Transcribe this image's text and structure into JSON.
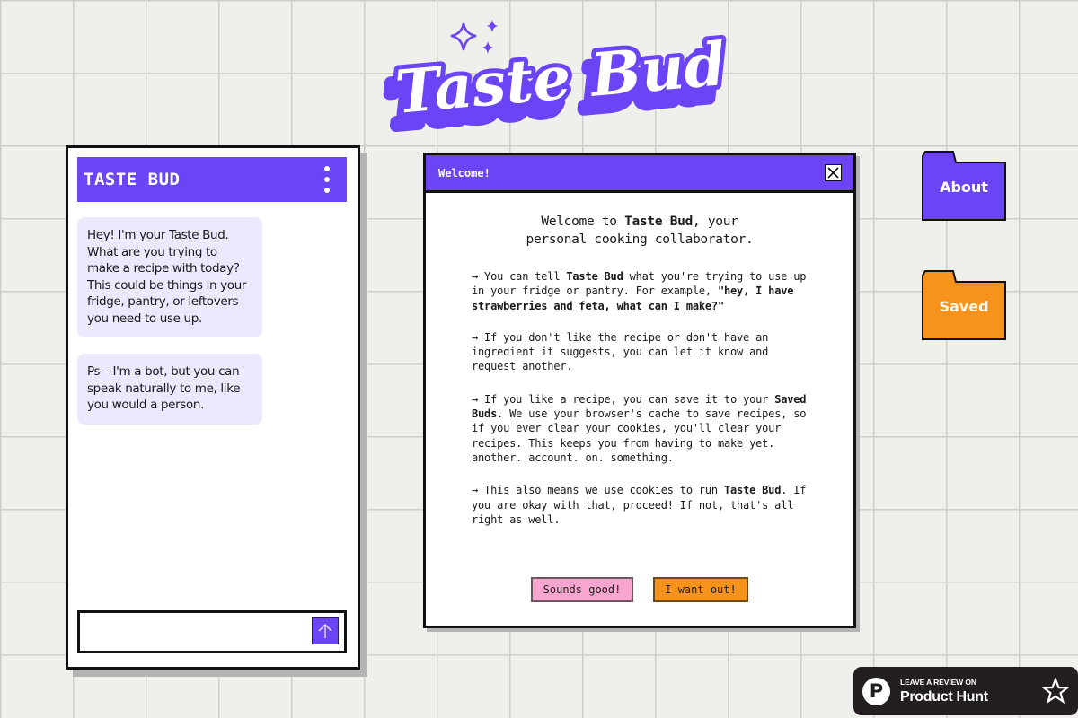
{
  "logo": {
    "text": "Taste Bud",
    "icon": "sparkle-stars-icon",
    "fill_color": "#ffffff",
    "shadow_color": "#6a44f5"
  },
  "chat": {
    "title": "TASTE BUD",
    "menu_icon": "kebab-menu-icon",
    "messages": [
      {
        "sender": "bot",
        "text": "Hey! I'm your Taste Bud. What are you trying to make a recipe with today? This could be things in your fridge, pantry, or leftovers you need to use up."
      },
      {
        "sender": "bot",
        "text": "Ps – I'm a bot, but you can speak naturally to me, like you would a person."
      }
    ],
    "input": {
      "value": "",
      "placeholder": ""
    },
    "send_icon": "arrow-up-icon",
    "accent_color": "#6a44f5",
    "bubble_color": "#ece8fd"
  },
  "modal": {
    "title": "Welcome!",
    "close_icon": "close-x-icon",
    "welcome": {
      "pre": "Welcome to ",
      "brand": "Taste Bud",
      "post": ", your personal cooking collaborator."
    },
    "paragraphs": [
      {
        "segments": [
          {
            "text": "→ You can tell ",
            "bold": false
          },
          {
            "text": "Taste Bud",
            "bold": true
          },
          {
            "text": " what you're trying to use up in your fridge or pantry. For example, ",
            "bold": false
          },
          {
            "text": "\"hey, I have strawberries and feta, what can I make?\"",
            "bold": true
          }
        ]
      },
      {
        "segments": [
          {
            "text": "→ If you don't like the recipe or don't have an ingredient it suggests, you can let it know and request another.",
            "bold": false
          }
        ]
      },
      {
        "segments": [
          {
            "text": "→ If you like a recipe, you can save it to your ",
            "bold": false
          },
          {
            "text": "Saved Buds",
            "bold": true
          },
          {
            "text": ". We use your browser's cache to save recipes, so if you ever clear your cookies, you'll clear your recipes. This keeps you from having to make yet. another. account. on. something.",
            "bold": false
          }
        ]
      },
      {
        "segments": [
          {
            "text": "→ This also means we use cookies to run ",
            "bold": false
          },
          {
            "text": "Taste Bud",
            "bold": true
          },
          {
            "text": ". If you are okay with that, proceed! If not, that's all right as well.",
            "bold": false
          }
        ]
      }
    ],
    "buttons": {
      "accept": "Sounds good!",
      "decline": "I want out!"
    },
    "colors": {
      "accept": "#f8a6cf",
      "decline": "#f7931a"
    }
  },
  "folders": [
    {
      "label": "About",
      "icon": "folder-icon",
      "color": "#6a44f5"
    },
    {
      "label": "Saved",
      "icon": "folder-icon",
      "color": "#f7931a"
    }
  ],
  "product_hunt": {
    "small_text": "LEAVE A REVIEW ON",
    "big_text": "Product Hunt",
    "logo_letter": "P",
    "logo_icon": "product-hunt-logo-icon",
    "star_icon": "star-outline-icon"
  }
}
